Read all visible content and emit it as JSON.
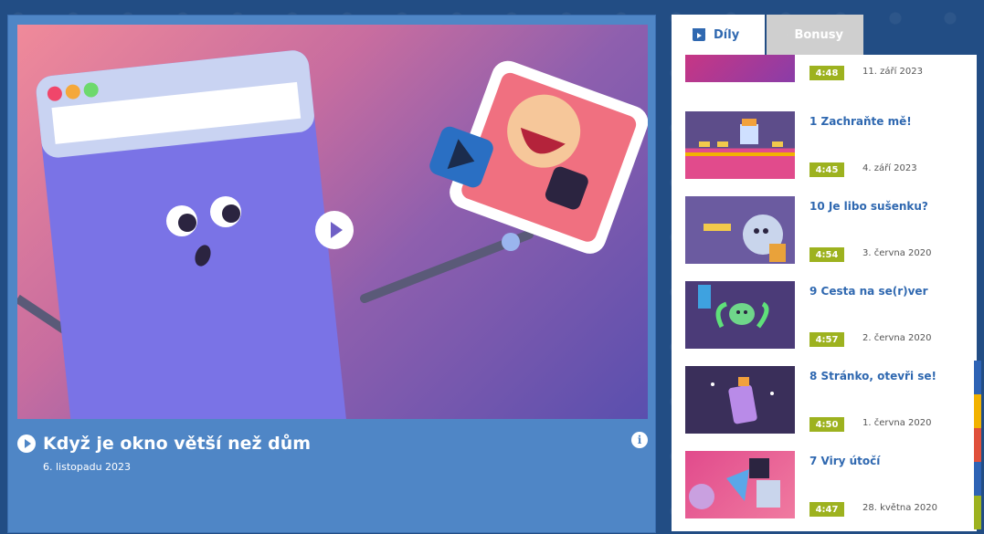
{
  "player": {
    "title": "Když je okno větší než dům",
    "date": "6. listopadu 2023",
    "info_icon": "i"
  },
  "tabs": [
    {
      "label": "Díly",
      "icon": "video-icon",
      "active": true
    },
    {
      "label": "Bonusy",
      "icon": "star-icon",
      "active": false
    }
  ],
  "episodes": [
    {
      "title": "",
      "duration": "4:48",
      "date": "11. září 2023"
    },
    {
      "title": "1 Zachraňte mě!",
      "duration": "4:45",
      "date": "4. září 2023"
    },
    {
      "title": "10 Je libo sušenku?",
      "duration": "4:54",
      "date": "3. června 2020"
    },
    {
      "title": "9 Cesta na se(r)ver",
      "duration": "4:57",
      "date": "2. června 2020"
    },
    {
      "title": "8 Stránko, otevři se!",
      "duration": "4:50",
      "date": "1. června 2020"
    },
    {
      "title": "7 Viry útočí",
      "duration": "4:47",
      "date": "28. května 2020"
    }
  ],
  "colors": {
    "panel_blue": "#4f86c6",
    "link_blue": "#2f68b0",
    "duration_green": "#9db21f",
    "background": "#224d84"
  }
}
